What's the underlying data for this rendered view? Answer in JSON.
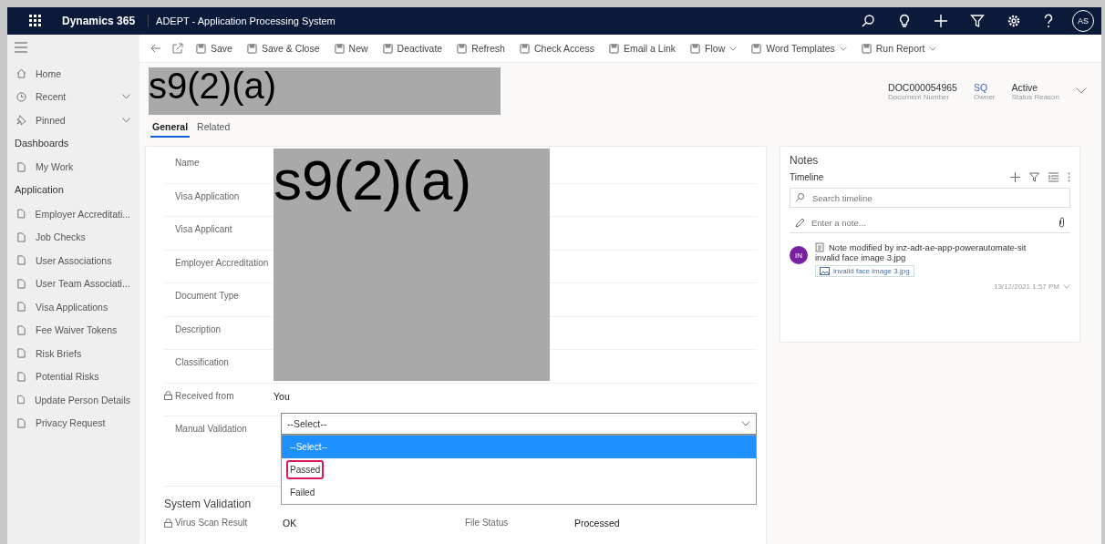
{
  "top_bar": {
    "app_name": "Dynamics 365",
    "title": "ADEPT - Application Processing System",
    "avatar": "AS"
  },
  "sidebar": {
    "items": [
      {
        "label": "Home",
        "chevron": false
      },
      {
        "label": "Recent",
        "chevron": true
      },
      {
        "label": "Pinned",
        "chevron": true
      }
    ],
    "sections": [
      {
        "heading": "Dashboards",
        "items": [
          {
            "label": "My Work"
          }
        ]
      },
      {
        "heading": "Application",
        "items": [
          {
            "label": "Employer Accreditati..."
          },
          {
            "label": "Job Checks"
          },
          {
            "label": "User Associations"
          },
          {
            "label": "User Team Associati..."
          },
          {
            "label": "Visa Applications"
          },
          {
            "label": "Fee Waiver Tokens"
          },
          {
            "label": "Risk Briefs"
          },
          {
            "label": "Potential Risks"
          },
          {
            "label": "Update Person Details"
          },
          {
            "label": "Privacy Request"
          }
        ]
      }
    ]
  },
  "command_bar": {
    "items": [
      {
        "label": "Save",
        "dropdown": false
      },
      {
        "label": "Save & Close",
        "dropdown": false
      },
      {
        "label": "New",
        "dropdown": false
      },
      {
        "label": "Deactivate",
        "dropdown": false
      },
      {
        "label": "Refresh",
        "dropdown": false
      },
      {
        "label": "Check Access",
        "dropdown": false
      },
      {
        "label": "Email a Link",
        "dropdown": false
      },
      {
        "label": "Flow",
        "dropdown": true
      },
      {
        "label": "Word Templates",
        "dropdown": true
      },
      {
        "label": "Run Report",
        "dropdown": true
      }
    ]
  },
  "header": {
    "redaction": "s9(2)(a)",
    "fields": [
      {
        "value": "DOC000054965",
        "label": "Document Number",
        "kind": "text"
      },
      {
        "value": "SQ",
        "label": "Owner",
        "kind": "link"
      },
      {
        "value": "Active",
        "label": "Status Reason",
        "kind": "text"
      }
    ]
  },
  "tabs": [
    {
      "label": "General",
      "selected": true
    },
    {
      "label": "Related",
      "selected": false
    }
  ],
  "form": {
    "labels": [
      "Name",
      "Visa Application",
      "Visa Applicant",
      "Employer Accreditation",
      "Document Type",
      "Description",
      "Classification"
    ],
    "redaction": "s9(2)(a)",
    "received_from": {
      "label": "Received from",
      "value": "You"
    },
    "manual_validation": {
      "label": "Manual Validation",
      "value": "--Select--",
      "expanded": true,
      "options": [
        {
          "label": "--Select--",
          "selected": true,
          "highlighted": false
        },
        {
          "label": "Passed",
          "selected": false,
          "highlighted": true
        },
        {
          "label": "Failed",
          "selected": false,
          "highlighted": false
        }
      ]
    },
    "system_validation": {
      "heading": "System Validation",
      "fields": [
        {
          "label": "Virus Scan Result",
          "value": "OK",
          "locked": true
        },
        {
          "label": "File Status",
          "value": "Processed",
          "locked": false
        }
      ]
    }
  },
  "notes": {
    "title": "Notes",
    "timeline": "Timeline",
    "search_placeholder": "Search timeline",
    "note_placeholder": "Enter a note...",
    "entries": [
      {
        "initials": "IN",
        "title": "Note modified by inz-adt-ae-app-powerautomate-sit",
        "text": "invalid face image 3.jpg",
        "attachment": "invalid face image 3.jpg",
        "time": "13/12/2021 1:57 PM"
      }
    ]
  }
}
